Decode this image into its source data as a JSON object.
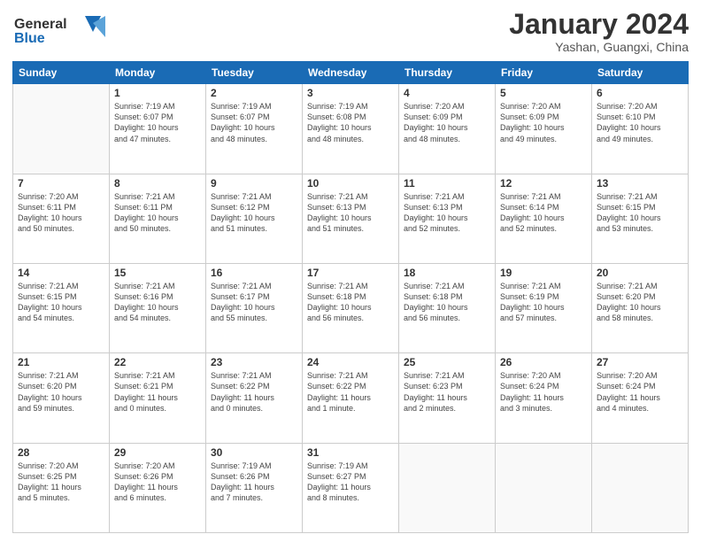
{
  "header": {
    "logo_line1": "General",
    "logo_line2": "Blue",
    "month": "January 2024",
    "location": "Yashan, Guangxi, China"
  },
  "days_of_week": [
    "Sunday",
    "Monday",
    "Tuesday",
    "Wednesday",
    "Thursday",
    "Friday",
    "Saturday"
  ],
  "weeks": [
    [
      {
        "day": "",
        "info": ""
      },
      {
        "day": "1",
        "info": "Sunrise: 7:19 AM\nSunset: 6:07 PM\nDaylight: 10 hours\nand 47 minutes."
      },
      {
        "day": "2",
        "info": "Sunrise: 7:19 AM\nSunset: 6:07 PM\nDaylight: 10 hours\nand 48 minutes."
      },
      {
        "day": "3",
        "info": "Sunrise: 7:19 AM\nSunset: 6:08 PM\nDaylight: 10 hours\nand 48 minutes."
      },
      {
        "day": "4",
        "info": "Sunrise: 7:20 AM\nSunset: 6:09 PM\nDaylight: 10 hours\nand 48 minutes."
      },
      {
        "day": "5",
        "info": "Sunrise: 7:20 AM\nSunset: 6:09 PM\nDaylight: 10 hours\nand 49 minutes."
      },
      {
        "day": "6",
        "info": "Sunrise: 7:20 AM\nSunset: 6:10 PM\nDaylight: 10 hours\nand 49 minutes."
      }
    ],
    [
      {
        "day": "7",
        "info": "Sunrise: 7:20 AM\nSunset: 6:11 PM\nDaylight: 10 hours\nand 50 minutes."
      },
      {
        "day": "8",
        "info": "Sunrise: 7:21 AM\nSunset: 6:11 PM\nDaylight: 10 hours\nand 50 minutes."
      },
      {
        "day": "9",
        "info": "Sunrise: 7:21 AM\nSunset: 6:12 PM\nDaylight: 10 hours\nand 51 minutes."
      },
      {
        "day": "10",
        "info": "Sunrise: 7:21 AM\nSunset: 6:13 PM\nDaylight: 10 hours\nand 51 minutes."
      },
      {
        "day": "11",
        "info": "Sunrise: 7:21 AM\nSunset: 6:13 PM\nDaylight: 10 hours\nand 52 minutes."
      },
      {
        "day": "12",
        "info": "Sunrise: 7:21 AM\nSunset: 6:14 PM\nDaylight: 10 hours\nand 52 minutes."
      },
      {
        "day": "13",
        "info": "Sunrise: 7:21 AM\nSunset: 6:15 PM\nDaylight: 10 hours\nand 53 minutes."
      }
    ],
    [
      {
        "day": "14",
        "info": "Sunrise: 7:21 AM\nSunset: 6:15 PM\nDaylight: 10 hours\nand 54 minutes."
      },
      {
        "day": "15",
        "info": "Sunrise: 7:21 AM\nSunset: 6:16 PM\nDaylight: 10 hours\nand 54 minutes."
      },
      {
        "day": "16",
        "info": "Sunrise: 7:21 AM\nSunset: 6:17 PM\nDaylight: 10 hours\nand 55 minutes."
      },
      {
        "day": "17",
        "info": "Sunrise: 7:21 AM\nSunset: 6:18 PM\nDaylight: 10 hours\nand 56 minutes."
      },
      {
        "day": "18",
        "info": "Sunrise: 7:21 AM\nSunset: 6:18 PM\nDaylight: 10 hours\nand 56 minutes."
      },
      {
        "day": "19",
        "info": "Sunrise: 7:21 AM\nSunset: 6:19 PM\nDaylight: 10 hours\nand 57 minutes."
      },
      {
        "day": "20",
        "info": "Sunrise: 7:21 AM\nSunset: 6:20 PM\nDaylight: 10 hours\nand 58 minutes."
      }
    ],
    [
      {
        "day": "21",
        "info": "Sunrise: 7:21 AM\nSunset: 6:20 PM\nDaylight: 10 hours\nand 59 minutes."
      },
      {
        "day": "22",
        "info": "Sunrise: 7:21 AM\nSunset: 6:21 PM\nDaylight: 11 hours\nand 0 minutes."
      },
      {
        "day": "23",
        "info": "Sunrise: 7:21 AM\nSunset: 6:22 PM\nDaylight: 11 hours\nand 0 minutes."
      },
      {
        "day": "24",
        "info": "Sunrise: 7:21 AM\nSunset: 6:22 PM\nDaylight: 11 hours\nand 1 minute."
      },
      {
        "day": "25",
        "info": "Sunrise: 7:21 AM\nSunset: 6:23 PM\nDaylight: 11 hours\nand 2 minutes."
      },
      {
        "day": "26",
        "info": "Sunrise: 7:20 AM\nSunset: 6:24 PM\nDaylight: 11 hours\nand 3 minutes."
      },
      {
        "day": "27",
        "info": "Sunrise: 7:20 AM\nSunset: 6:24 PM\nDaylight: 11 hours\nand 4 minutes."
      }
    ],
    [
      {
        "day": "28",
        "info": "Sunrise: 7:20 AM\nSunset: 6:25 PM\nDaylight: 11 hours\nand 5 minutes."
      },
      {
        "day": "29",
        "info": "Sunrise: 7:20 AM\nSunset: 6:26 PM\nDaylight: 11 hours\nand 6 minutes."
      },
      {
        "day": "30",
        "info": "Sunrise: 7:19 AM\nSunset: 6:26 PM\nDaylight: 11 hours\nand 7 minutes."
      },
      {
        "day": "31",
        "info": "Sunrise: 7:19 AM\nSunset: 6:27 PM\nDaylight: 11 hours\nand 8 minutes."
      },
      {
        "day": "",
        "info": ""
      },
      {
        "day": "",
        "info": ""
      },
      {
        "day": "",
        "info": ""
      }
    ]
  ]
}
